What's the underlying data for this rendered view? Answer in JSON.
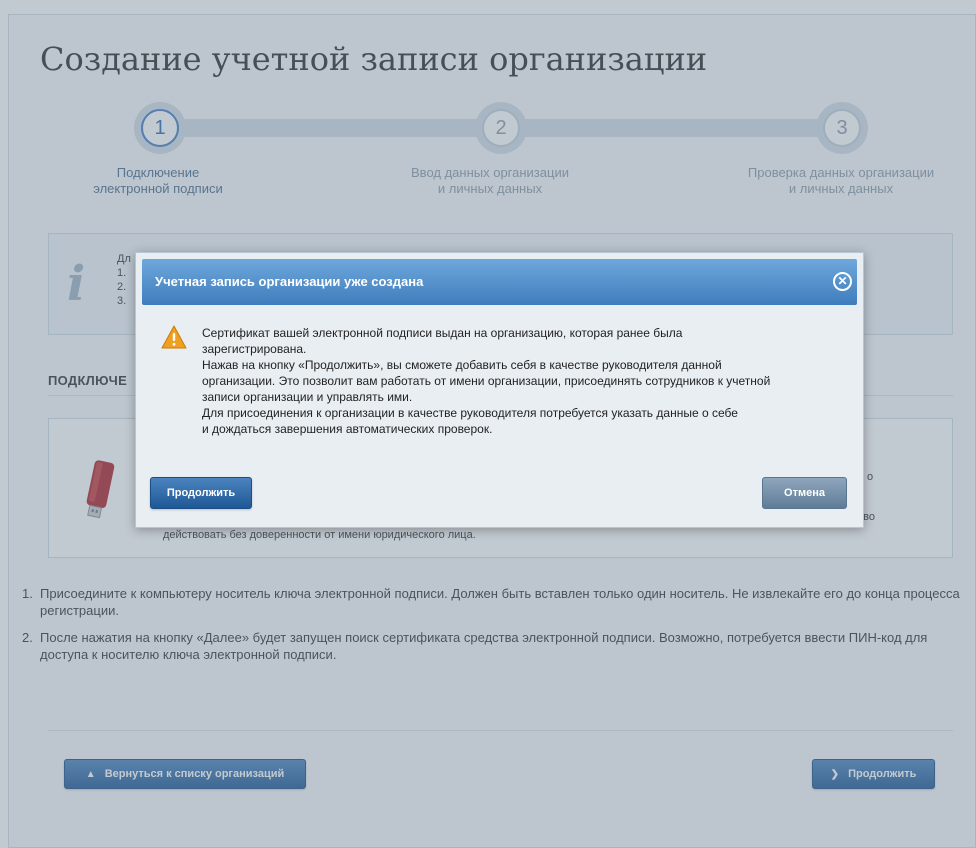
{
  "page": {
    "title": "Создание учетной записи организации"
  },
  "steps": [
    {
      "number": "1",
      "label_line1": "Подключение",
      "label_line2": "электронной подписи",
      "active": true
    },
    {
      "number": "2",
      "label_line1": "Ввод данных организации",
      "label_line2": "и личных данных",
      "active": false
    },
    {
      "number": "3",
      "label_line1": "Проверка данных организации",
      "label_line2": "и личных данных",
      "active": false
    }
  ],
  "info_box": {
    "icon": "info-icon",
    "line_0": "Дл",
    "line_1": "1.",
    "line_2": "2.",
    "line_3": "3."
  },
  "section": {
    "title": "ПОДКЛЮЧЕ"
  },
  "token_box": {
    "partial_right_1": "о",
    "partial_right_2": "аво",
    "description": "действовать без доверенности от имени юридического лица."
  },
  "instructions": [
    {
      "num": "1.",
      "text": "Присоедините к компьютеру носитель ключа электронной подписи. Должен быть вставлен только один носитель. Не извлекайте его до конца процесса регистрации."
    },
    {
      "num": "2.",
      "text": "После нажатия на кнопку «Далее» будет запущен поиск сертификата средства электронной подписи. Возможно, потребуется ввести ПИН-код для доступа к носителю ключа электронной подписи."
    }
  ],
  "buttons": {
    "back_label": "Вернуться к списку организаций",
    "back_icon": "home-icon",
    "next_label": "Продолжить",
    "next_icon": "chevron-right-icon"
  },
  "modal": {
    "title": "Учетная запись организации уже создана",
    "close_icon": "close-icon",
    "warning_icon": "warning-icon",
    "text_line_1": "Сертификат вашей электронной подписи выдан на организацию, которая ранее была",
    "text_line_2": "зарегистрирована.",
    "text_line_3": "Нажав на кнопку «Продолжить», вы сможете добавить себя в качестве руководителя данной",
    "text_line_4": "организации. Это позволит вам работать от имени организации, присоединять сотрудников к учетной",
    "text_line_5": "записи организации и управлять ими.",
    "text_line_6": "Для присоединения к организации в качестве руководителя потребуется указать данные о себе",
    "text_line_7": "и дождаться завершения автоматических проверок.",
    "ok_label": "Продолжить",
    "cancel_label": "Отмена"
  },
  "colors": {
    "accent": "#2b6cb1",
    "header_gradient_top": "#6ea7db",
    "header_gradient_bottom": "#3f7dbd",
    "warning": "#f0a020"
  }
}
